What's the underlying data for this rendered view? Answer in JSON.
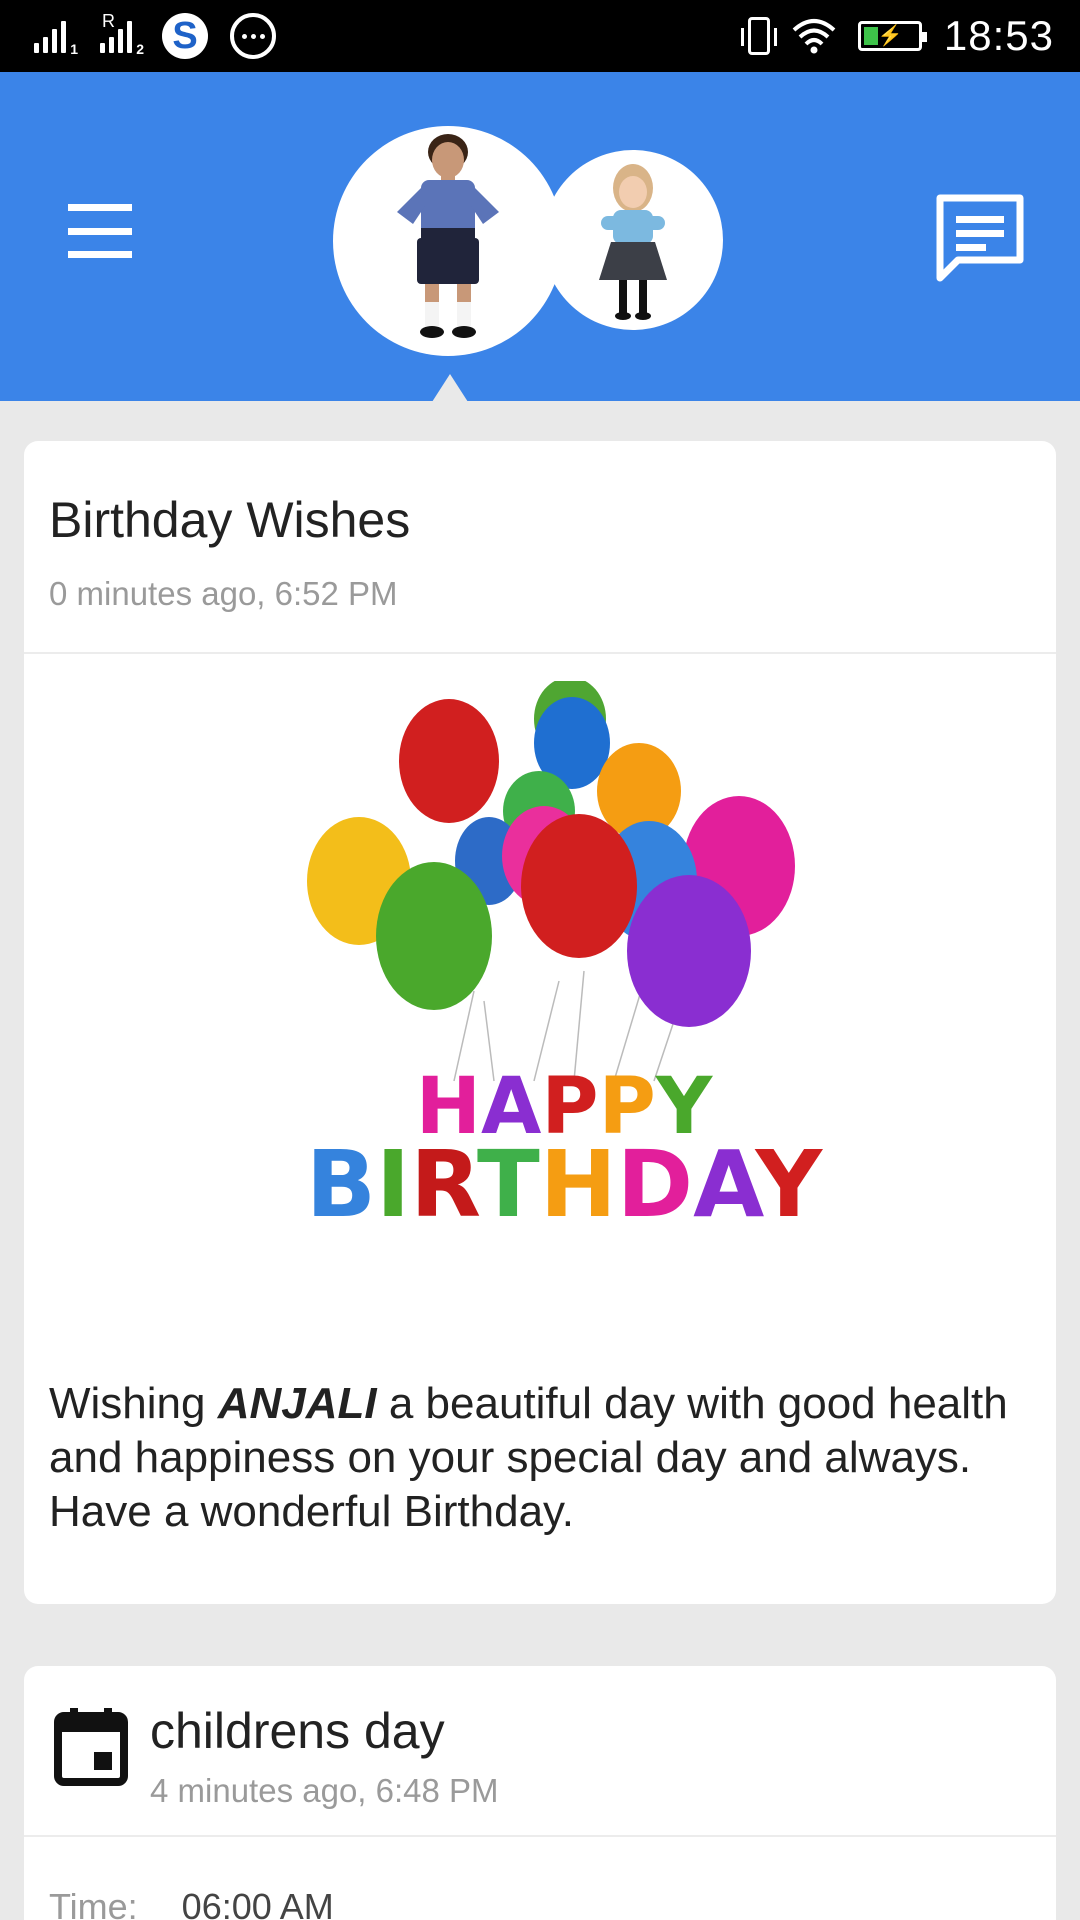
{
  "status_bar": {
    "sim1": "1",
    "sim2": "2",
    "roaming": "R",
    "app_icon_letter": "S",
    "time": "18:53",
    "battery_color": "#3ec34a"
  },
  "header": {
    "background_color": "#3b84e8",
    "avatars": [
      "student-boy",
      "student-girl"
    ]
  },
  "cards": [
    {
      "title": "Birthday Wishes",
      "timestamp": "0 minutes ago, 6:52 PM",
      "image": "happy-birthday-balloons",
      "image_text": [
        "HAPPY",
        "BIRTHDAY"
      ],
      "message_pre": "Wishing ",
      "message_name": "ANJALI",
      "message_post": " a beautiful day with good health and happiness on your special day and always. Have a wonderful Birthday."
    },
    {
      "icon": "calendar-icon",
      "title": "childrens day",
      "timestamp": "4 minutes ago, 6:48 PM",
      "detail_label": "Time:",
      "detail_value": "06:00 AM"
    }
  ]
}
